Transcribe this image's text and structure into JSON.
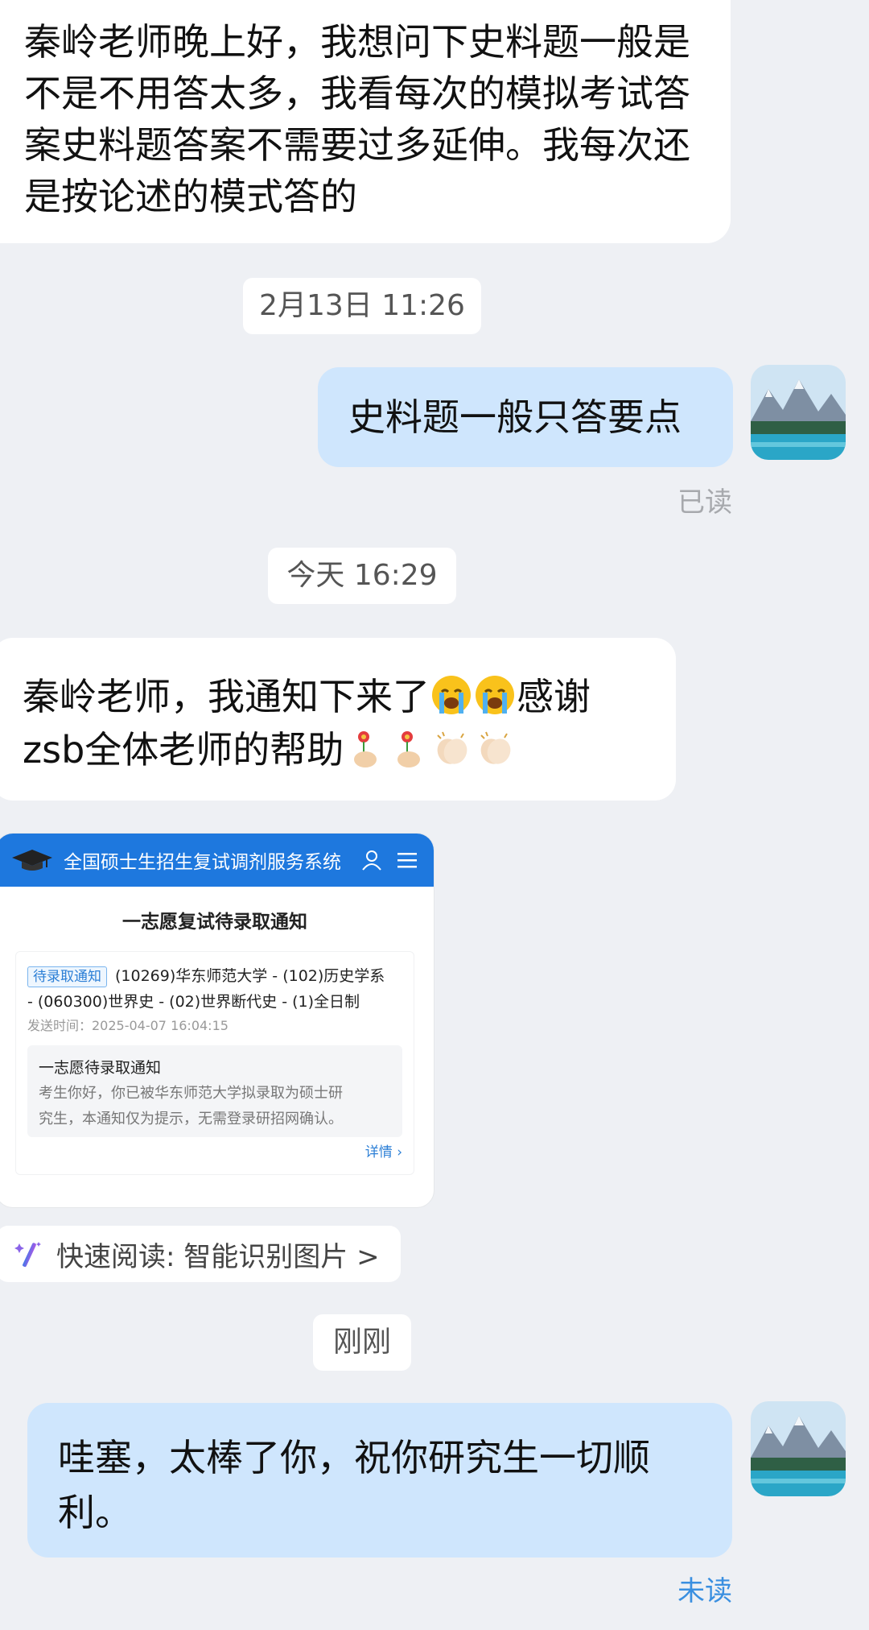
{
  "messages": {
    "msg1": "秦岭老师晚上好，我想问下史料题一般是不是不用答太多，我看每次的模拟考试答案史料题答案不需要过多延伸。我每次还是按论述的模式答的",
    "msg2": "史料题一般只答要点",
    "msg3_line1": "秦岭老师，我通知下来了",
    "msg3_line1_end": "感谢",
    "msg3_line2": "zsb全体老师的帮助",
    "msg4": "哇塞，太棒了你，祝你研究生一切顺利。"
  },
  "timestamps": {
    "ts1": "2月13日 11:26",
    "ts2": "今天 16:29",
    "ts3": "刚刚"
  },
  "status": {
    "read": "已读",
    "unread": "未读"
  },
  "colors": {
    "incoming_bubble": "#ffffff",
    "outgoing_bubble": "#cfe6fd",
    "unread_status": "#3a8fe0",
    "card_header": "#1e78de"
  },
  "icons": {
    "emoji_crying": "loudly-crying-face",
    "emoji_flower": "flower-in-hand",
    "emoji_clap": "clapping-hands",
    "quick_read": "magic-wand-icon",
    "card_logo": "graduation-cap-icon",
    "card_user": "user-icon",
    "card_menu": "menu-icon"
  },
  "card": {
    "header_title": "全国硕士生招生复试调剂服务系统",
    "subtitle": "一志愿复试待录取通知",
    "tag": "待录取通知",
    "program_line1": "(10269)华东师范大学 - (102)历史学系",
    "program_line2": "- (060300)世界史 - (02)世界断代史 - (1)全日制",
    "send_time": "发送时间：2025-04-07 16:04:15",
    "inner_title": "一志愿待录取通知",
    "inner_text_line1": "考生你好，你已被华东师范大学拟录取为硕士研",
    "inner_text_line2": "究生，本通知仅为提示，无需登录研招网确认。",
    "detail": "详情 ›"
  },
  "quick_read": "快速阅读: 智能识别图片 >"
}
